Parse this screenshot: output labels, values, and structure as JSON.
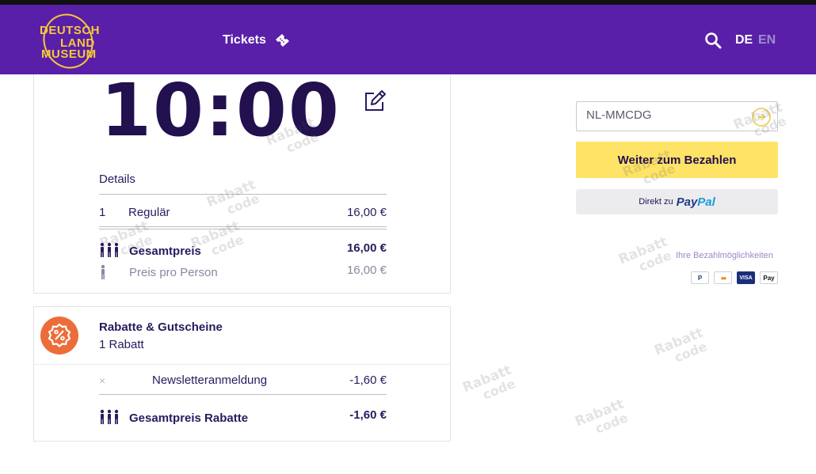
{
  "header": {
    "logo_lines": [
      "DEUTSCH",
      "LAND",
      "MUSEUM"
    ],
    "nav_tickets": "Tickets",
    "lang_de": "DE",
    "lang_en": "EN",
    "bg_color": "#5a1fa8",
    "logo_color": "#f5c93a"
  },
  "booking": {
    "time": "10:00",
    "details_label": "Details",
    "line_items": [
      {
        "qty": "1",
        "name": "Regulär",
        "price": "16,00 €"
      }
    ],
    "total_label": "Gesamtpreis",
    "total_value": "16,00 €",
    "per_person_label": "Preis pro Person",
    "per_person_value": "16,00 €"
  },
  "discounts": {
    "title": "Rabatte & Gutscheine",
    "subtitle": "1 Rabatt",
    "remove_symbol": "×",
    "items": [
      {
        "name": "Newsletteranmeldung",
        "value": "-1,60 €"
      }
    ],
    "total_label": "Gesamtpreis Rabatte",
    "total_value": "-1,60 €",
    "badge_color": "#ec6d3a"
  },
  "checkout": {
    "coupon_value": "NL-MMCDG",
    "pay_button": "Weiter zum Bezahlen",
    "paypal_prefix": "Direkt zu",
    "paypal_brand_1": "Pay",
    "paypal_brand_2": "Pal",
    "payment_methods_label": "Ihre Bezahlmöglichkeiten",
    "payment_methods": [
      "P",
      "●●",
      "VISA",
      "Pay"
    ],
    "button_color": "#ffe366"
  },
  "watermark": {
    "line1": "Rabatt",
    "line2": "code"
  }
}
